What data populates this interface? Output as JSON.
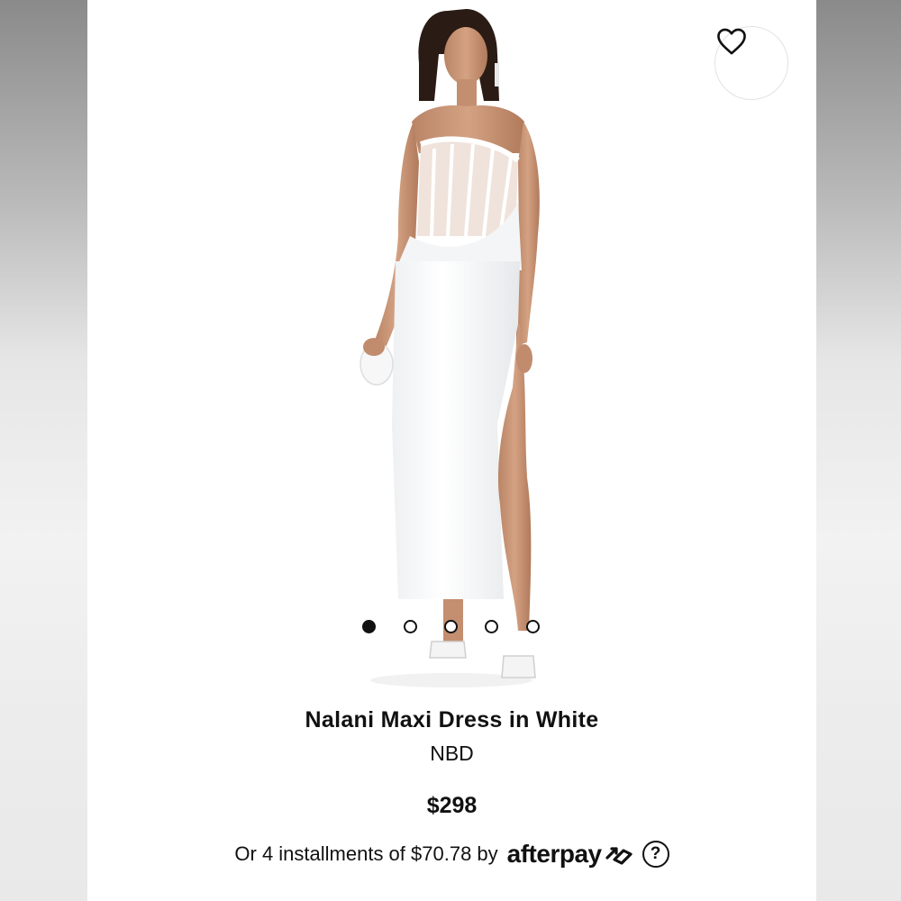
{
  "product": {
    "title": "Nalani Maxi Dress in White",
    "brand": "NBD",
    "price": "$298"
  },
  "payment": {
    "installments_text": "Or 4 installments of $70.78 by",
    "provider": "afterpay",
    "help_glyph": "?"
  },
  "gallery": {
    "image_count": 5,
    "active_index": 0
  },
  "icons": {
    "favorite": "heart-icon",
    "afterpay": "afterpay-arrows-icon",
    "help": "question-circle-icon"
  },
  "colors": {
    "text": "#111111",
    "background": "#ffffff"
  }
}
